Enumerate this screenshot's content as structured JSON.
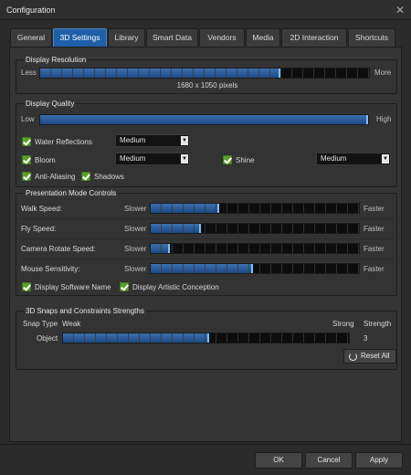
{
  "window": {
    "title": "Configuration"
  },
  "tabs": [
    {
      "label": "General"
    },
    {
      "label": "3D Settings"
    },
    {
      "label": "Library"
    },
    {
      "label": "Smart Data"
    },
    {
      "label": "Vendors"
    },
    {
      "label": "Media"
    },
    {
      "label": "2D Interaction"
    },
    {
      "label": "Shortcuts"
    }
  ],
  "display_resolution": {
    "title": "Display Resolution",
    "min_label": "Less",
    "max_label": "More",
    "value_text": "1680 x 1050 pixels",
    "level": 0.73
  },
  "display_quality": {
    "title": "Display Quality",
    "min_label": "Low",
    "max_label": "High",
    "level": 1.0,
    "water_reflections": {
      "label": "Water Reflections",
      "checked": true,
      "value": "Medium"
    },
    "bloom": {
      "label": "Bloom",
      "checked": true,
      "value": "Medium"
    },
    "shine": {
      "label": "Shine",
      "checked": true,
      "value": "Medium"
    },
    "anti_aliasing": {
      "label": "Anti-Aliasing",
      "checked": true
    },
    "shadows": {
      "label": "Shadows",
      "checked": true
    }
  },
  "presentation": {
    "title": "Presentation Mode Controls",
    "rows": [
      {
        "label": "Walk Speed:",
        "min": "Slower",
        "max": "Faster",
        "level": 0.33
      },
      {
        "label": "Fly Speed:",
        "min": "Slower",
        "max": "Faster",
        "level": 0.24
      },
      {
        "label": "Camera Rotate Speed:",
        "min": "Slower",
        "max": "Faster",
        "level": 0.09
      },
      {
        "label": "Mouse Sensitivity:",
        "min": "Slower",
        "max": "Faster",
        "level": 0.49
      }
    ],
    "display_software_name": {
      "label": "Display Software Name",
      "checked": true
    },
    "display_artistic_conception": {
      "label": "Display Artistic Conception",
      "checked": true
    }
  },
  "snaps": {
    "title": "3D Snaps and Constraints Strengths",
    "col_type": "Snap Type",
    "col_weak": "Weak",
    "col_strong": "Strong",
    "col_strength": "Strength",
    "rows": [
      {
        "label": "Object",
        "value": "3",
        "level": 0.51
      }
    ],
    "reset_label": "Reset All"
  },
  "buttons": {
    "ok": "OK",
    "cancel": "Cancel",
    "apply": "Apply"
  }
}
